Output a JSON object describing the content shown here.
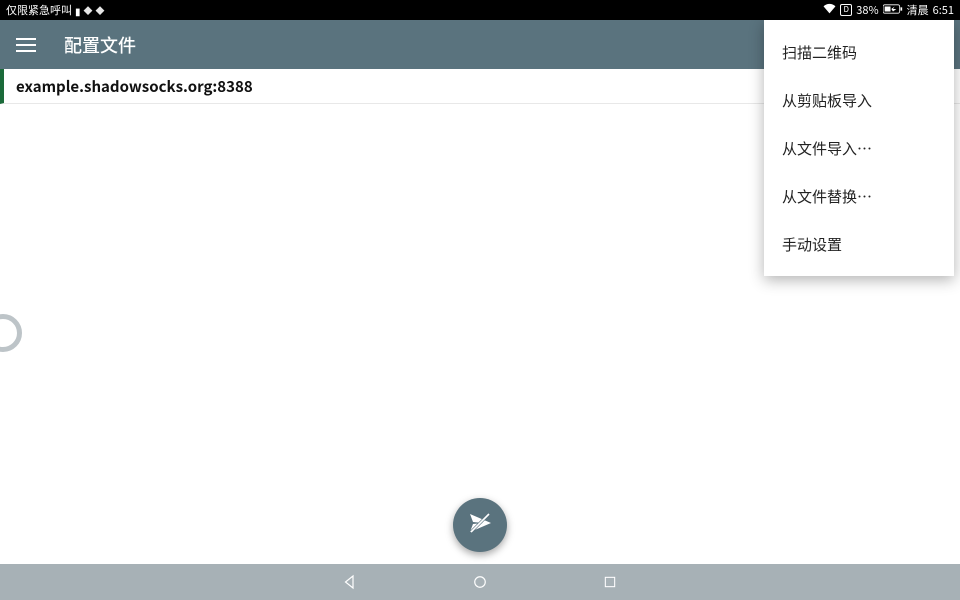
{
  "statusbar": {
    "emergency_label": "仅限紧急呼叫",
    "battery_pct": "38%",
    "time_prefix": "清晨",
    "time": "6:51"
  },
  "appbar": {
    "title": "配置文件"
  },
  "profiles": {
    "items": [
      {
        "name": "example.shadowsocks.org:8388"
      }
    ]
  },
  "menu": {
    "items": [
      {
        "label": "扫描二维码"
      },
      {
        "label": "从剪贴板导入"
      },
      {
        "label": "从文件导入…"
      },
      {
        "label": "从文件替换…"
      },
      {
        "label": "手动设置"
      }
    ]
  }
}
